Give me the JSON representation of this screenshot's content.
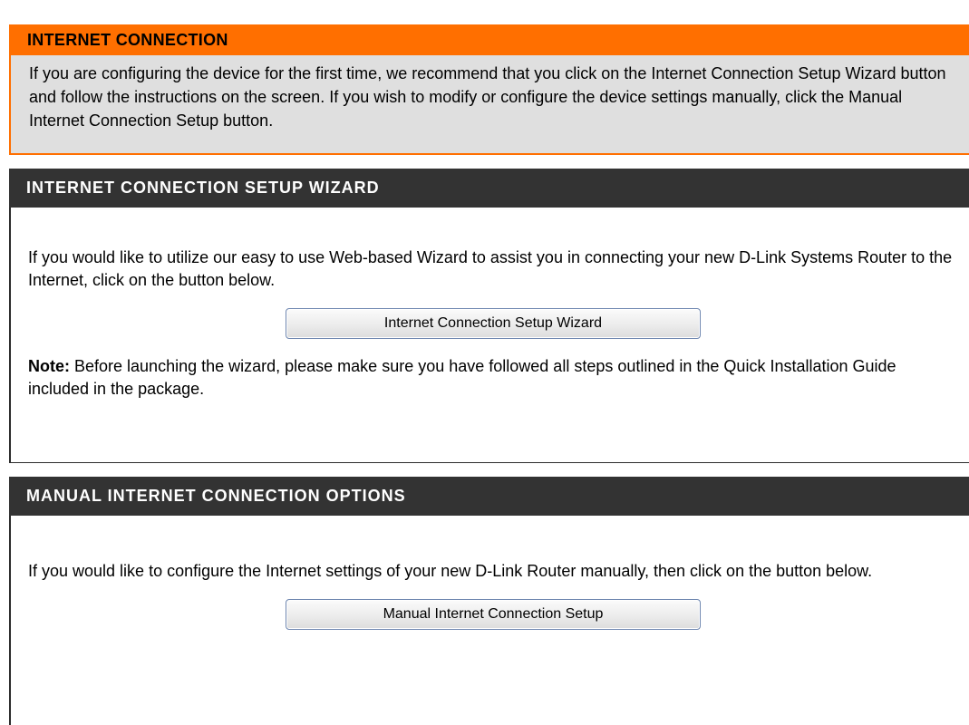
{
  "internet_connection": {
    "title": "INTERNET CONNECTION",
    "description": "If you are configuring the device for the first time, we recommend that you click on the Internet Connection Setup Wizard button and follow the instructions on the screen. If you wish to modify or configure the device settings manually, click the Manual Internet Connection Setup button."
  },
  "wizard_section": {
    "title": "INTERNET CONNECTION SETUP WIZARD",
    "description": "If you would like to utilize our easy to use Web-based Wizard to assist you in connecting your new D-Link Systems Router to the Internet, click on the button below.",
    "button_label": "Internet Connection Setup Wizard",
    "note_label": "Note:",
    "note_text": " Before launching the wizard, please make sure you have followed all steps outlined in the Quick Installation Guide included in the package."
  },
  "manual_section": {
    "title": "MANUAL INTERNET CONNECTION OPTIONS",
    "description": "If you would like to configure the Internet settings of your new D-Link Router manually, then click on the button below.",
    "button_label": "Manual Internet Connection Setup"
  },
  "colors": {
    "accent_orange": "#ff6f00",
    "section_header_dark": "#333333",
    "intro_background": "#dfdfdf"
  }
}
